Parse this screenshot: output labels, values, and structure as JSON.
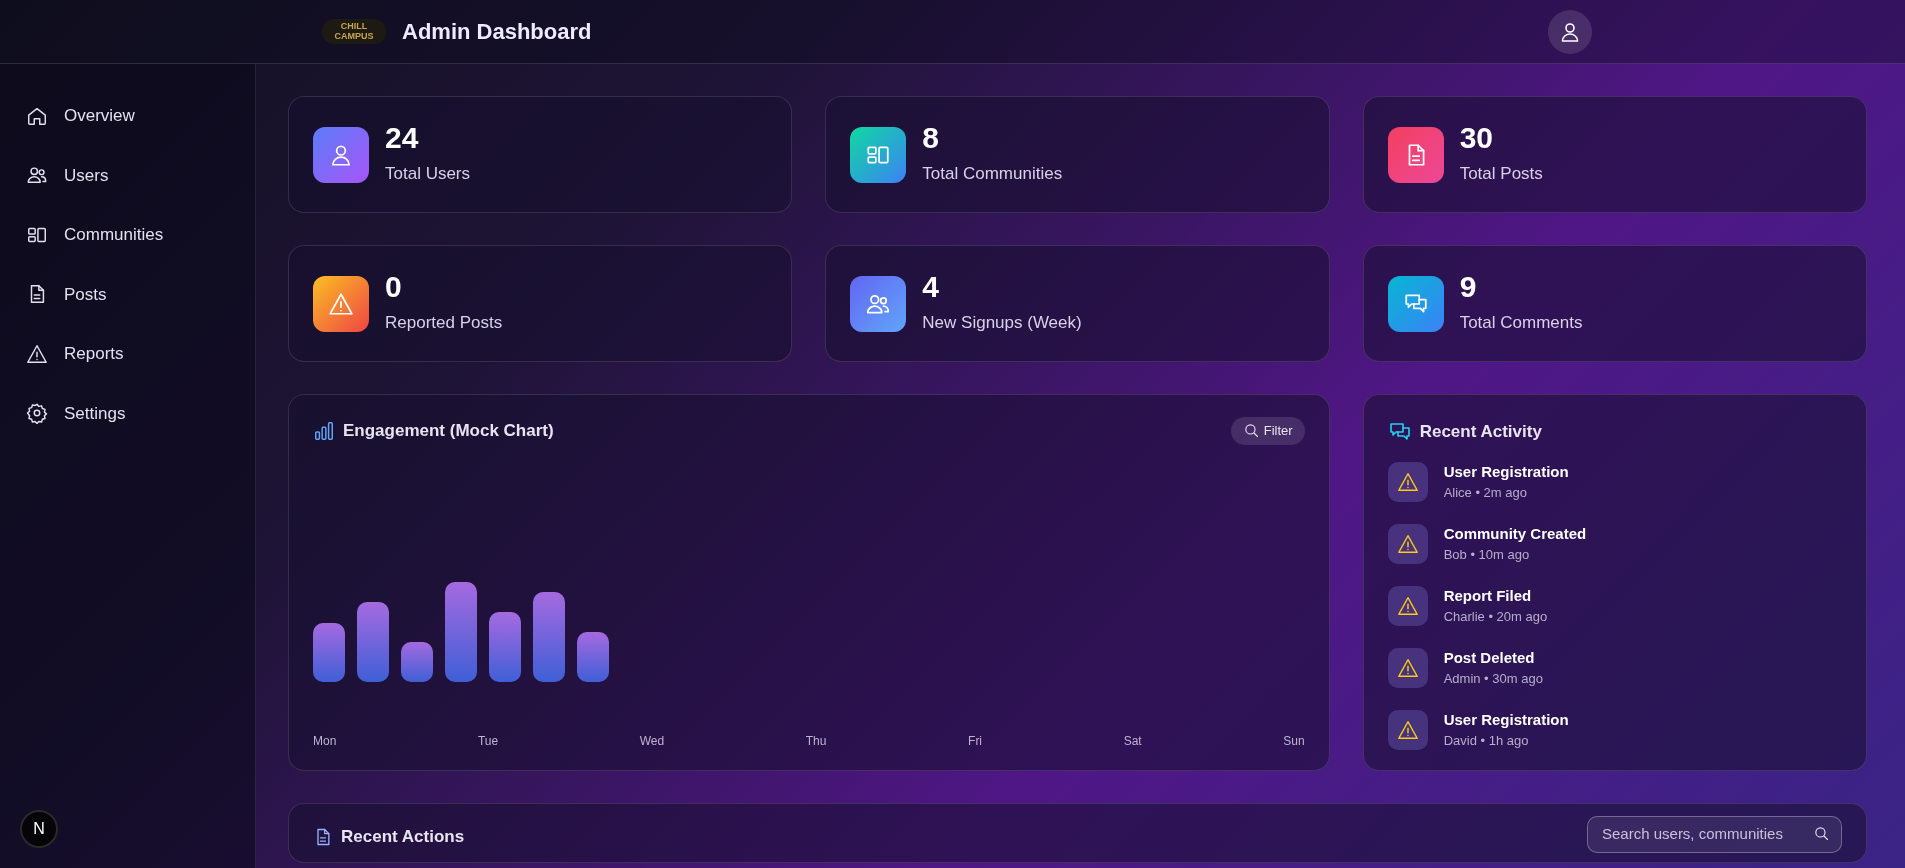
{
  "header": {
    "logo_text": "CHILL CAMPUS",
    "title": "Admin Dashboard"
  },
  "sidebar": {
    "items": [
      {
        "label": "Overview",
        "kind": "home",
        "selected": false
      },
      {
        "label": "Users",
        "kind": "users",
        "selected": false
      },
      {
        "label": "Communities",
        "kind": "communities",
        "selected": false
      },
      {
        "label": "Posts",
        "kind": "posts",
        "selected": false
      },
      {
        "label": "Reports",
        "kind": "reports",
        "selected": false
      },
      {
        "label": "Settings",
        "kind": "settings",
        "selected": false
      }
    ],
    "dev_badge": "N"
  },
  "stats": [
    {
      "value": "24",
      "label": "Total Users",
      "kind": "users"
    },
    {
      "value": "8",
      "label": "Total Communities",
      "kind": "communities"
    },
    {
      "value": "30",
      "label": "Total Posts",
      "kind": "posts"
    },
    {
      "value": "0",
      "label": "Reported Posts",
      "kind": "reports"
    },
    {
      "value": "4",
      "label": "New Signups (Week)",
      "kind": "signups"
    },
    {
      "value": "9",
      "label": "Total Comments",
      "kind": "comments"
    }
  ],
  "engagement": {
    "title": "Engagement (Mock Chart)",
    "filter_button": "Filter",
    "x_labels": [
      "Mon",
      "Tue",
      "Wed",
      "Thu",
      "Fri",
      "Sat",
      "Sun"
    ]
  },
  "recent_activity": {
    "title": "Recent Activity",
    "items": [
      {
        "title": "User Registration",
        "meta": "Alice • 2m ago"
      },
      {
        "title": "Community Created",
        "meta": "Bob • 10m ago"
      },
      {
        "title": "Report Filed",
        "meta": "Charlie • 20m ago"
      },
      {
        "title": "Post Deleted",
        "meta": "Admin • 30m ago"
      },
      {
        "title": "User Registration",
        "meta": "David • 1h ago"
      }
    ]
  },
  "recent_actions": {
    "title": "Recent Actions",
    "search": {
      "placeholder": "Search users, communities"
    }
  }
}
